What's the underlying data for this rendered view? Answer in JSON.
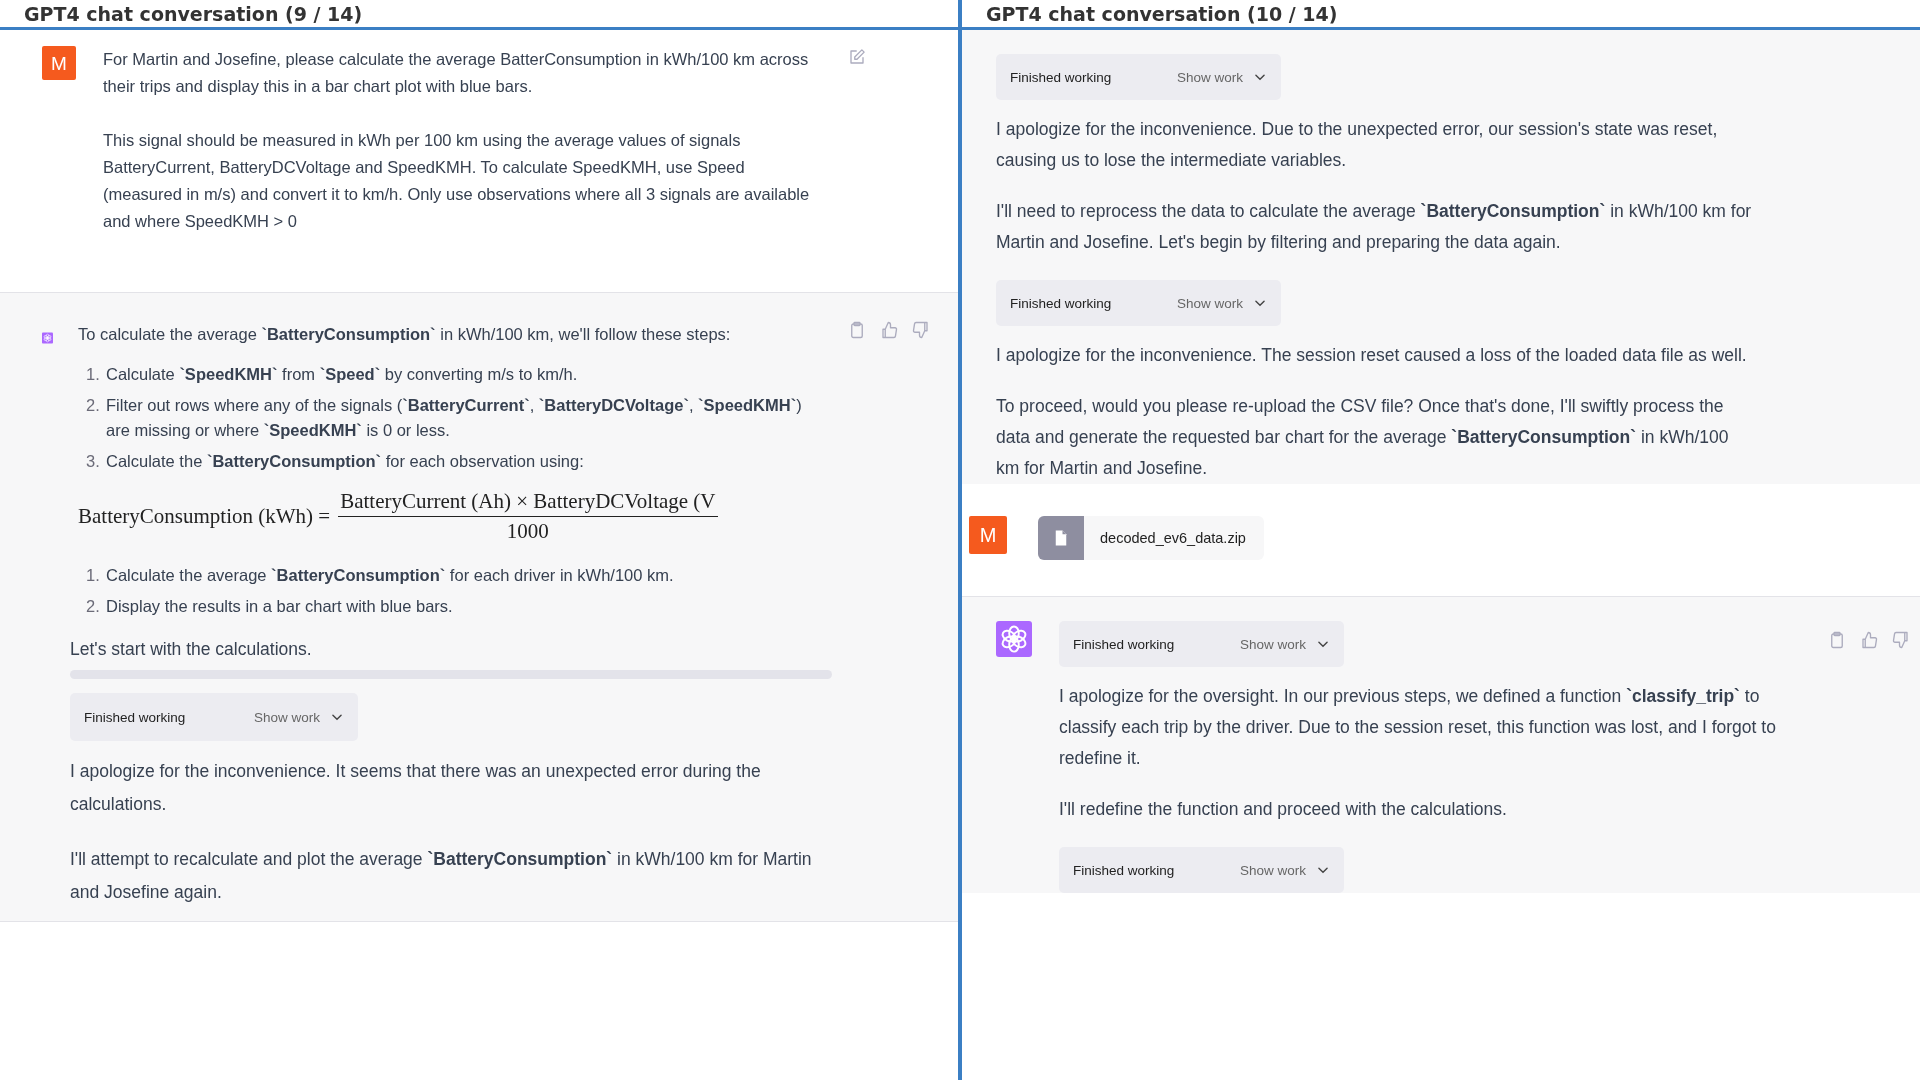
{
  "panels": [
    {
      "title": "GPT4 chat conversation (9 / 14)",
      "messages": [
        {
          "kind": "user_prompt",
          "avatar": "M",
          "blocks": [
            {
              "kind": "paragraph",
              "text": "For Martin and Josefine, please calculate the average BatterConsumption in kWh/100 km across their trips and display this in a bar chart plot with blue bars."
            },
            {
              "kind": "paragraph",
              "text": "This signal should be measured in kWh per 100 km using the average values of signals BatteryCurrent, BatteryDCVoltage and SpeedKMH. To calculate SpeedKMH, use Speed (measured in m/s) and convert it to km/h. Only use observations where all 3 signals are available and where SpeedKMH > 0"
            }
          ]
        },
        {
          "kind": "assistant",
          "blocks": [
            {
              "kind": "paragraph",
              "text": "To calculate the average **`BatteryConsumption`** in kWh/100 km, we'll follow these steps:"
            },
            {
              "kind": "list",
              "items": [
                {
                  "number": "1.",
                  "text": "Calculate **`SpeedKMH`** from **`Speed`** by converting m/s to km/h."
                },
                {
                  "number": "2.",
                  "text": "Filter out rows where any of the signals (**`BatteryCurrent`**, **`BatteryDCVoltage`**, **`SpeedKMH`**) are missing or where **`SpeedKMH`** is 0 or less."
                },
                {
                  "number": "3.",
                  "text": "Calculate the **`BatteryConsumption`** for each observation using:"
                }
              ]
            },
            {
              "kind": "formula",
              "lhs": "BatteryConsumption (kWh) =",
              "numerator": "BatteryCurrent (Ah) × BatteryDCVoltage (V",
              "denominator": "1000"
            },
            {
              "kind": "list",
              "items": [
                {
                  "number": "1.",
                  "text": "Calculate the average **`BatteryConsumption`** for each driver in kWh/100 km."
                },
                {
                  "number": "2.",
                  "text": "Display the results in a bar chart with blue bars."
                }
              ]
            },
            {
              "kind": "paragraph",
              "text": "Let's start with the calculations."
            },
            {
              "kind": "bar"
            },
            {
              "kind": "status",
              "label": "Finished working",
              "button": "Show work"
            },
            {
              "kind": "paragraph",
              "text": "I apologize for the inconvenience. It seems that there was an unexpected error during the calculations."
            },
            {
              "kind": "paragraph",
              "text": "I'll attempt to recalculate and plot the average **`BatteryConsumption`** in kWh/100 km for Martin and Josefine again."
            }
          ]
        }
      ]
    },
    {
      "title": "GPT4 chat conversation (10 / 14)",
      "messages": [
        {
          "kind": "assistant_continued",
          "blocks": [
            {
              "kind": "status",
              "label": "Finished working",
              "button": "Show work"
            },
            {
              "kind": "paragraph",
              "text": "I apologize for the inconvenience. Due to the unexpected error, our session's state was reset, causing us to lose the intermediate variables."
            },
            {
              "kind": "paragraph",
              "text": "I'll need to reprocess the data to calculate the average **`BatteryConsumption`** in kWh/100 km for Martin and Josefine. Let's begin by filtering and preparing the data again."
            },
            {
              "kind": "status",
              "label": "Finished working",
              "button": "Show work"
            },
            {
              "kind": "paragraph",
              "text": "I apologize for the inconvenience. The session reset caused a loss of the loaded data file as well."
            },
            {
              "kind": "paragraph",
              "text": "To proceed, would you please re-upload the CSV file? Once that's done, I'll swiftly process the data and generate the requested bar chart for the average **`BatteryConsumption`** in kWh/100 km for Martin and Josefine."
            }
          ]
        },
        {
          "kind": "user_upload",
          "avatar": "M",
          "blocks": [
            {
              "kind": "file",
              "name": "decoded_ev6_data.zip"
            }
          ]
        },
        {
          "kind": "assistant",
          "blocks": [
            {
              "kind": "status",
              "label": "Finished working",
              "button": "Show work"
            },
            {
              "kind": "paragraph",
              "text": "I apologize for the oversight. In our previous steps, we defined a function **`classify_trip`** to classify each trip by the driver. Due to the session reset, this function was lost, and I forgot to redefine it."
            },
            {
              "kind": "paragraph",
              "text": "I'll redefine the function and proceed with the calculations."
            },
            {
              "kind": "status",
              "label": "Finished working",
              "button": "Show work"
            }
          ]
        }
      ]
    }
  ]
}
